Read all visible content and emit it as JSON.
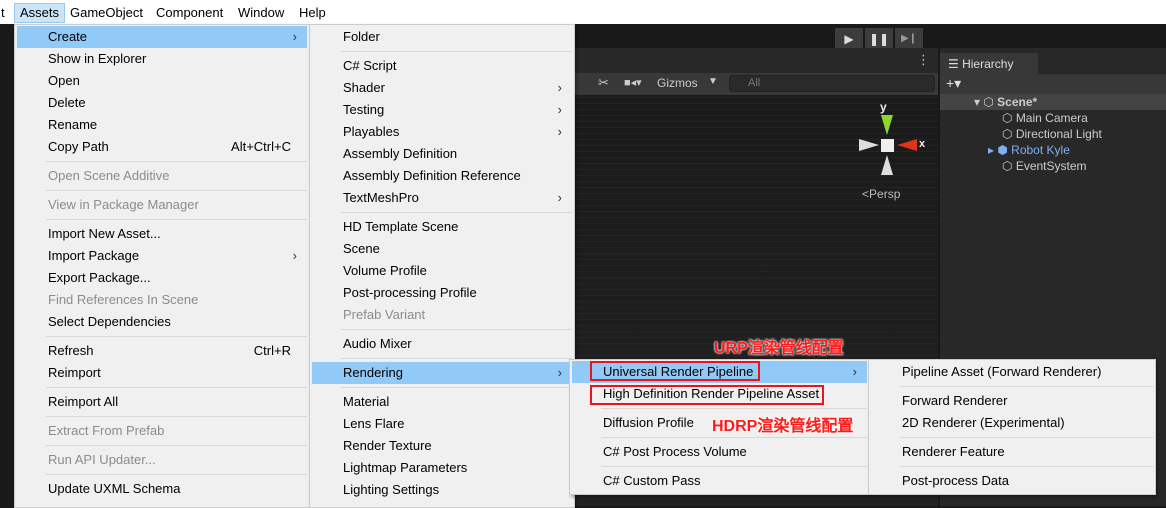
{
  "menubar": {
    "items": [
      "t",
      "Assets",
      "GameObject",
      "Component",
      "Window",
      "Help"
    ]
  },
  "toolbar": {
    "play": "▶",
    "pause": "❚❚",
    "step": "▶❙"
  },
  "scene": {
    "gizmos": "Gizmos",
    "search_placeholder": "All",
    "persp": "Persp",
    "axis_y": "y",
    "axis_x": "x"
  },
  "hierarchy": {
    "title": "Hierarchy",
    "add": "+▾",
    "scene": "Scene*",
    "items": [
      "Main Camera",
      "Directional Light",
      "Robot Kyle",
      "EventSystem"
    ],
    "selected_color": "#7cb0f0"
  },
  "menus": [
    {
      "id": "assets-menu",
      "items": [
        {
          "label": "Create",
          "arrow": true,
          "hl": true
        },
        {
          "label": "Show in Explorer"
        },
        {
          "label": "Open"
        },
        {
          "label": "Delete"
        },
        {
          "label": "Rename"
        },
        {
          "label": "Copy Path",
          "shortcut": "Alt+Ctrl+C"
        },
        {
          "sep": true
        },
        {
          "label": "Open Scene Additive",
          "disabled": true
        },
        {
          "sep": true
        },
        {
          "label": "View in Package Manager",
          "disabled": true
        },
        {
          "sep": true
        },
        {
          "label": "Import New Asset..."
        },
        {
          "label": "Import Package",
          "arrow": true
        },
        {
          "label": "Export Package..."
        },
        {
          "label": "Find References In Scene",
          "disabled": true
        },
        {
          "label": "Select Dependencies"
        },
        {
          "sep": true
        },
        {
          "label": "Refresh",
          "shortcut": "Ctrl+R"
        },
        {
          "label": "Reimport"
        },
        {
          "sep": true
        },
        {
          "label": "Reimport All"
        },
        {
          "sep": true
        },
        {
          "label": "Extract From Prefab",
          "disabled": true
        },
        {
          "sep": true
        },
        {
          "label": "Run API Updater...",
          "disabled": true
        },
        {
          "sep": true
        },
        {
          "label": "Update UXML Schema"
        }
      ]
    },
    {
      "id": "create-menu",
      "items": [
        {
          "label": "Folder"
        },
        {
          "sep": true
        },
        {
          "label": "C# Script"
        },
        {
          "label": "Shader",
          "arrow": true
        },
        {
          "label": "Testing",
          "arrow": true
        },
        {
          "label": "Playables",
          "arrow": true
        },
        {
          "label": "Assembly Definition"
        },
        {
          "label": "Assembly Definition Reference"
        },
        {
          "label": "TextMeshPro",
          "arrow": true
        },
        {
          "sep": true
        },
        {
          "label": "HD Template Scene"
        },
        {
          "label": "Scene"
        },
        {
          "label": "Volume Profile"
        },
        {
          "label": "Post-processing Profile"
        },
        {
          "label": "Prefab Variant",
          "disabled": true
        },
        {
          "sep": true
        },
        {
          "label": "Audio Mixer"
        },
        {
          "sep": true
        },
        {
          "label": "Rendering",
          "arrow": true,
          "hl": true
        },
        {
          "sep": true
        },
        {
          "label": "Material"
        },
        {
          "label": "Lens Flare"
        },
        {
          "label": "Render Texture"
        },
        {
          "label": "Lightmap Parameters"
        },
        {
          "label": "Lighting Settings"
        }
      ]
    },
    {
      "id": "rendering-menu",
      "items": [
        {
          "label": "Universal Render Pipeline",
          "arrow": true,
          "hl": true
        },
        {
          "label": "High Definition Render Pipeline Asset"
        },
        {
          "sep": true
        },
        {
          "label": "Diffusion Profile"
        },
        {
          "sep": true
        },
        {
          "label": "C# Post Process Volume"
        },
        {
          "sep": true
        },
        {
          "label": "C# Custom Pass"
        }
      ]
    },
    {
      "id": "urp-menu",
      "items": [
        {
          "label": "Pipeline Asset (Forward Renderer)"
        },
        {
          "sep": true
        },
        {
          "label": "Forward Renderer"
        },
        {
          "label": "2D Renderer (Experimental)"
        },
        {
          "sep": true
        },
        {
          "label": "Renderer Feature"
        },
        {
          "sep": true
        },
        {
          "label": "Post-process Data"
        }
      ]
    }
  ],
  "annotations": {
    "urp": "URP渲染管线配置",
    "hdrp": "HDRP渲染管线配置",
    "color": "#e8141e"
  }
}
